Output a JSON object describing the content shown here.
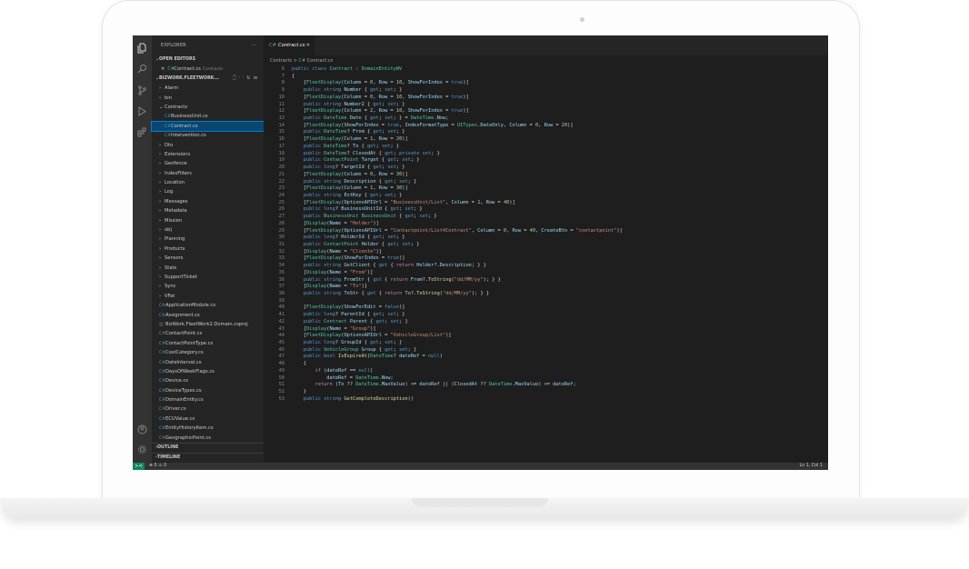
{
  "sidebar": {
    "title": "EXPLORER",
    "more": "···",
    "open_editors_label": "OPEN EDITORS",
    "open_editor": {
      "close": "✕",
      "name": "Contract.cs",
      "folder": "Contracts"
    },
    "project_label": "BIZWORK.FLEETWORK...",
    "project_actions": "🗋 🗀 ↻ ⊟",
    "tree": [
      {
        "label": "Alarm",
        "type": "folder",
        "depth": 1,
        "open": false
      },
      {
        "label": "bin",
        "type": "folder",
        "depth": 1,
        "open": false
      },
      {
        "label": "Contracts",
        "type": "folder",
        "depth": 1,
        "open": true
      },
      {
        "label": "BusinessUnit.cs",
        "type": "cs",
        "depth": 2
      },
      {
        "label": "Contract.cs",
        "type": "cs",
        "depth": 2,
        "selected": true
      },
      {
        "label": "Intervention.cs",
        "type": "cs",
        "depth": 2
      },
      {
        "label": "Dto",
        "type": "folder",
        "depth": 1,
        "open": false
      },
      {
        "label": "Extensions",
        "type": "folder",
        "depth": 1,
        "open": false
      },
      {
        "label": "Geofence",
        "type": "folder",
        "depth": 1,
        "open": false
      },
      {
        "label": "IndexFilters",
        "type": "folder",
        "depth": 1,
        "open": false
      },
      {
        "label": "Location",
        "type": "folder",
        "depth": 1,
        "open": false
      },
      {
        "label": "Log",
        "type": "folder",
        "depth": 1,
        "open": false
      },
      {
        "label": "Messages",
        "type": "folder",
        "depth": 1,
        "open": false
      },
      {
        "label": "Metadata",
        "type": "folder",
        "depth": 1,
        "open": false
      },
      {
        "label": "Mission",
        "type": "folder",
        "depth": 1,
        "open": false
      },
      {
        "label": "obj",
        "type": "folder",
        "depth": 1,
        "open": false
      },
      {
        "label": "Planning",
        "type": "folder",
        "depth": 1,
        "open": false
      },
      {
        "label": "Products",
        "type": "folder",
        "depth": 1,
        "open": false
      },
      {
        "label": "Sensors",
        "type": "folder",
        "depth": 1,
        "open": false
      },
      {
        "label": "Stats",
        "type": "folder",
        "depth": 1,
        "open": false
      },
      {
        "label": "SupportTicket",
        "type": "folder",
        "depth": 1,
        "open": false
      },
      {
        "label": "Sync",
        "type": "folder",
        "depth": 1,
        "open": false
      },
      {
        "label": "VFat",
        "type": "folder",
        "depth": 1,
        "open": false
      },
      {
        "label": "ApplicationModule.cs",
        "type": "cs",
        "depth": 1
      },
      {
        "label": "Assignment.cs",
        "type": "cs",
        "depth": 1
      },
      {
        "label": "BizWork.FleetWork2.Domain.csproj",
        "type": "xml",
        "depth": 1
      },
      {
        "label": "ContactPoint.cs",
        "type": "cs",
        "depth": 1
      },
      {
        "label": "ContactPointType.cs",
        "type": "cs",
        "depth": 1
      },
      {
        "label": "CostCategory.cs",
        "type": "cs",
        "depth": 1
      },
      {
        "label": "DateInterval.cs",
        "type": "cs",
        "depth": 1
      },
      {
        "label": "DaysOfWeekFlags.cs",
        "type": "cs",
        "depth": 1
      },
      {
        "label": "Device.cs",
        "type": "cs",
        "depth": 1
      },
      {
        "label": "DeviceTypes.cs",
        "type": "cs",
        "depth": 1
      },
      {
        "label": "DomainEntity.cs",
        "type": "cs",
        "depth": 1
      },
      {
        "label": "Driver.cs",
        "type": "cs",
        "depth": 1
      },
      {
        "label": "ECUValue.cs",
        "type": "cs",
        "depth": 1
      },
      {
        "label": "EntityHistoryItem.cs",
        "type": "cs",
        "depth": 1
      },
      {
        "label": "GeographicPoint.cs",
        "type": "cs",
        "depth": 1
      }
    ],
    "outline_label": "OUTLINE",
    "timeline_label": "TIMELINE"
  },
  "activity_icons": [
    "files-icon",
    "search-icon",
    "source-control-icon",
    "run-debug-icon",
    "extensions-icon"
  ],
  "activity_bottom_icons": [
    "account-icon",
    "settings-icon"
  ],
  "editor": {
    "tab_label": "Contract.cs",
    "tab_close": "✕",
    "breadcrumb_folder": "Contracts",
    "breadcrumb_sep": ">",
    "breadcrumb_file": "Contract.cs",
    "first_line_number": 6,
    "lines": [
      "public class Contract : DomainEntityWV",
      "{",
      "    [FleetDisplay(Column = 0, Row = 10, ShowForIndex = true)]",
      "    public string Number { get; set; }",
      "    [FleetDisplay(Column = 0, Row = 10, ShowForIndex = true)]",
      "    public string Number2 { get; set; }",
      "    [FleetDisplay(Column = 2, Row = 10, ShowForIndex = true)]",
      "    public DateTime Date { get; set; } = DateTime.Now;",
      "    [FleetDisplay(ShowForIndex = true, IndexFormatType = UITypes.DateOnly, Column = 0, Row = 20)]",
      "    public DateTime? From { get; set; }",
      "    [FleetDisplay(Column = 1, Row = 20)]",
      "    public DateTime? To { get; set; }",
      "    public DateTime? ClosedAt { get; private set; }",
      "    public ContactPoint Target { get; set; }",
      "    public long? TargetId { get; set; }",
      "    [FleetDisplay(Column = 0, Row = 30)]",
      "    public string Description { get; set; }",
      "    [FleetDisplay(Column = 1, Row = 30)]",
      "    public string ExtKey { get; set; }",
      "    [FleetDisplay(OptionsAPIUrl = \"BusinessUnit/List\", Column = 1, Row = 40)]",
      "    public long? BusinessUnitId { get; set; }",
      "    public BusinessUnit BusinessUnit { get; set; }",
      "    [Display(Name = \"Holder\")]",
      "    [FleetDisplay(OptionsAPIUrl = \"Contactpoint/List4Contract\", Column = 0, Row = 40, CreateBtn = \"contactpoint\")]",
      "    public long? HolderId { get; set; }",
      "    public ContactPoint Holder { get; set; }",
      "    [Display(Name = \"Cliente\")]",
      "    [FleetDisplay(ShowForIndex = true)]",
      "    public string GetClient { get { return Holder?.Description; } }",
      "    [Display(Name = \"From\")]",
      "    public string FromStr { get { return From?.ToString(\"dd/MM/yy\"); } }",
      "    [Display(Name = \"To\")]",
      "    public string ToStr { get { return To?.ToString(\"dd/MM/yy\"); } }",
      "",
      "    [FleetDisplay(ShowForEdit = false)]",
      "    public long? ParentId { get; set; }",
      "    public Contract Parent { get; set; }",
      "    [Display(Name = \"Group\")]",
      "    [FleetDisplay(OptionsAPIUrl = \"VehicleGroup/List\")]",
      "    public long? GroupId { get; set; }",
      "    public VehicleGroup Group { get; set; }",
      "    public bool IsExpireAt(DateTime? dateRef = null)",
      "    {",
      "        if (dateRef == null)",
      "            dateRef = DateTime.Now;",
      "        return (To ?? DateTime.MaxValue) <= dateRef || (ClosedAt ?? DateTime.MaxValue) <= dateRef;",
      "    }",
      "    public string GetCompleteDescription()"
    ]
  },
  "status": {
    "remote": "≻≺",
    "problems": "⊗ 0 ⚠ 0",
    "position": "Ln 1, Col 1"
  }
}
